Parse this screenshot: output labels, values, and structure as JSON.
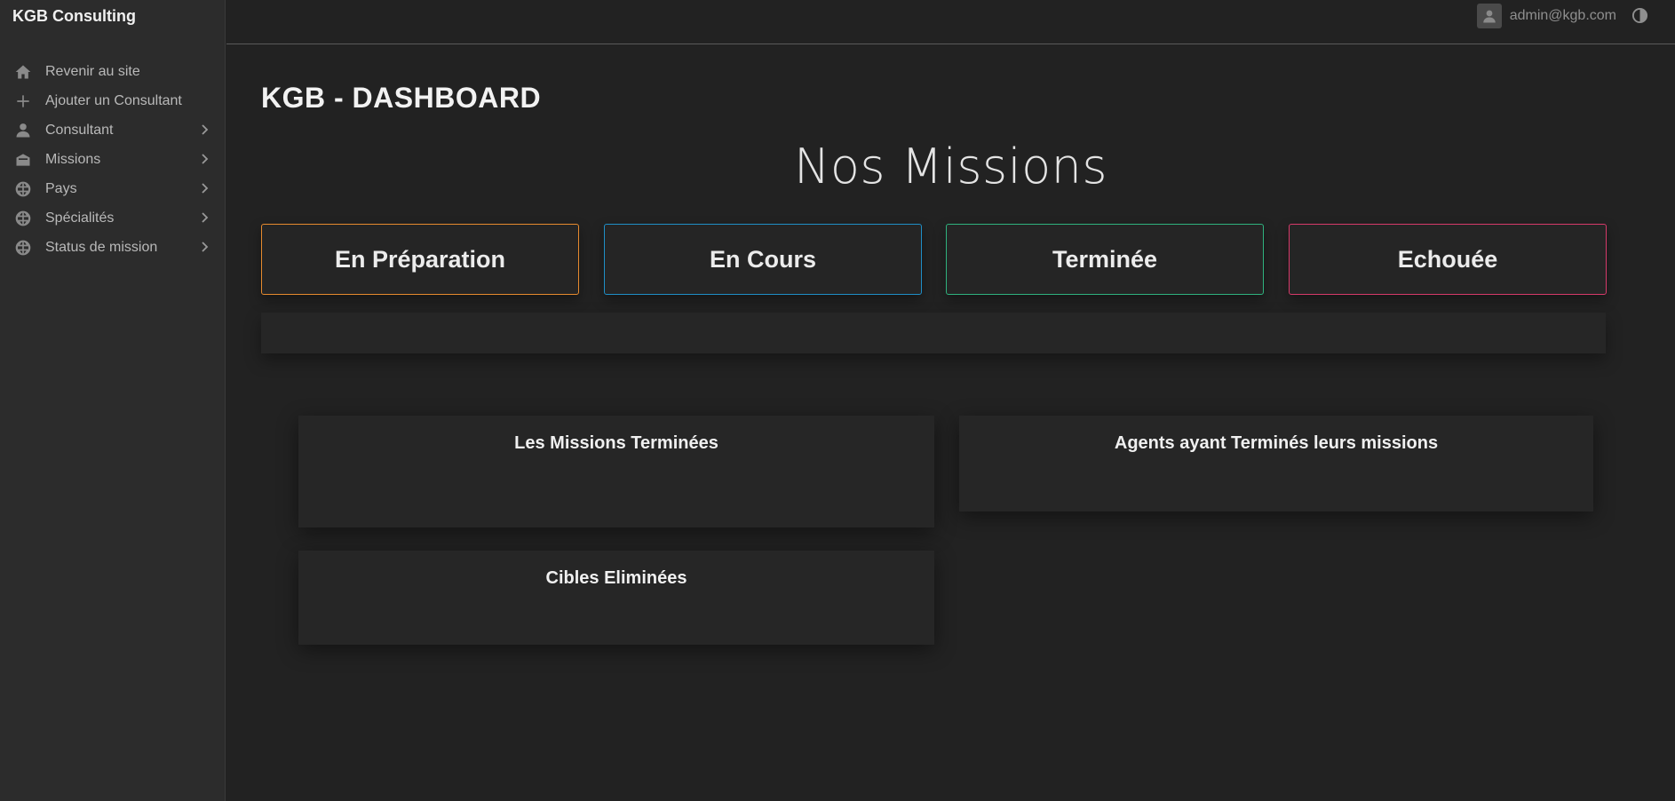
{
  "sidebar": {
    "brand": "KGB Consulting",
    "items": [
      {
        "label": "Revenir au site",
        "icon": "home-icon"
      },
      {
        "label": "Ajouter un Consultant",
        "icon": "plus-icon"
      },
      {
        "label": "Consultant",
        "icon": "user-icon"
      },
      {
        "label": "Missions",
        "icon": "mailbox-icon"
      },
      {
        "label": "Pays",
        "icon": "globe-icon"
      },
      {
        "label": "Spécialités",
        "icon": "globe-icon"
      },
      {
        "label": "Status de mission",
        "icon": "globe-icon"
      }
    ]
  },
  "header": {
    "user_email": "admin@kgb.com",
    "user_icon": "user-avatar-icon",
    "theme_icon": "contrast-icon"
  },
  "main": {
    "page_title": "KGB - DASHBOARD",
    "section_title": "Nos Missions",
    "status_cards": [
      {
        "label": "En Préparation",
        "color": "#e68a2e"
      },
      {
        "label": "En Cours",
        "color": "#1f8fc7"
      },
      {
        "label": "Terminée",
        "color": "#2fb27e"
      },
      {
        "label": "Echouée",
        "color": "#d63a6a"
      }
    ],
    "panels": {
      "missions_terminees": "Les Missions Terminées",
      "agents_termines": "Agents ayant Terminés leurs missions",
      "cibles_eliminees": "Cibles Eliminées"
    }
  }
}
